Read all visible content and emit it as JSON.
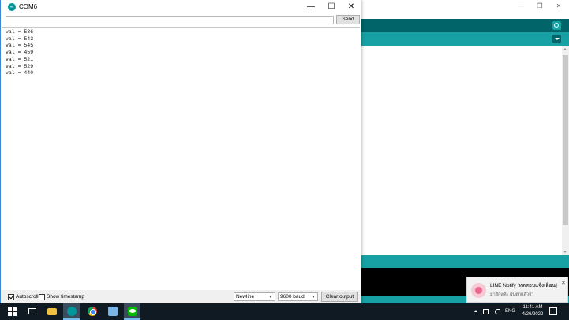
{
  "serial_monitor": {
    "title": "COM6",
    "send_input": {
      "value": "",
      "placeholder": ""
    },
    "send_label": "Send",
    "output_lines": [
      "val = 536",
      "val = 543",
      "val = 545",
      "val = 459",
      "val = 521",
      "val = 529",
      "val = 440"
    ],
    "autoscroll_label": "Autoscroll",
    "autoscroll_checked": true,
    "timestamp_label": "Show timestamp",
    "timestamp_checked": false,
    "line_ending": "Newline",
    "baud_rate": "9600 baud",
    "clear_label": "Clear output"
  },
  "notification": {
    "title": "LINE Notify [ทดสอบแจ้งเตือน]",
    "body": "มาฮิกแค้ะ ฝนตกแล้วจ้า",
    "close": "✕"
  },
  "taskbar": {
    "language": "ENG",
    "time": "11:41 AM",
    "date": "4/26/2022"
  },
  "colors": {
    "ide_dark_teal": "#006468",
    "ide_teal": "#17a1a5",
    "taskbar": "#0f1a22",
    "window_border": "#3c8ad6"
  }
}
